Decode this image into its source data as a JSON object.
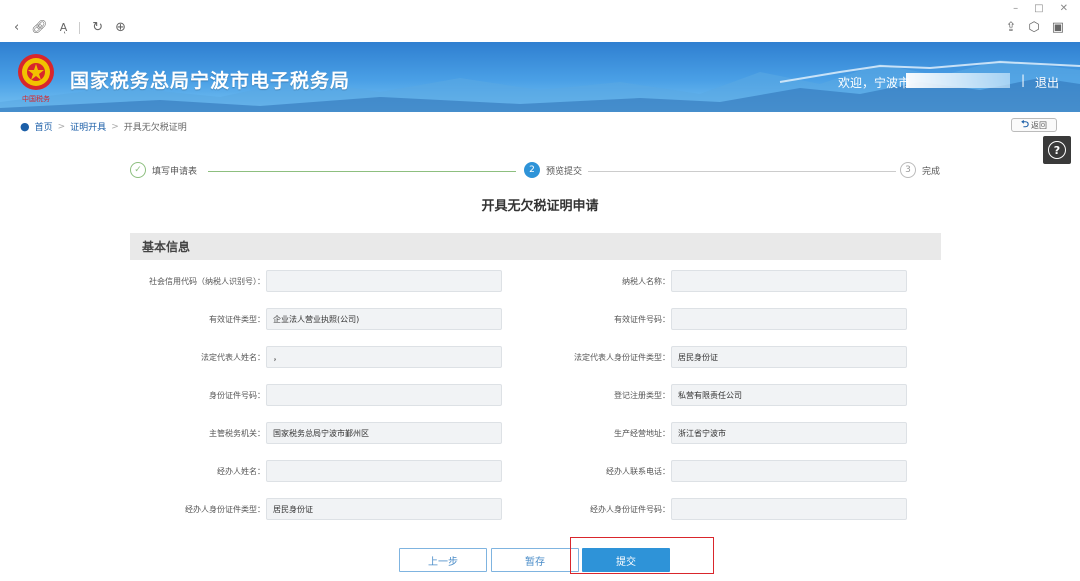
{
  "chrome": {
    "nav_icons": [
      "back-icon",
      "link-icon",
      "read-aloud-icon",
      "refresh-icon",
      "compass-icon"
    ],
    "window_icons": [
      "minimize-icon",
      "restore-icon",
      "close-icon"
    ],
    "right_icons": [
      "share-icon",
      "extension-icon",
      "collections-icon"
    ]
  },
  "header": {
    "title": "国家税务总局宁波市电子税务局",
    "welcome": "欢迎，宁波市",
    "divider": "|",
    "logout": "退出",
    "colors": {
      "banner_top": "#2f7fd0",
      "banner_bottom": "#79c3f2"
    }
  },
  "breadcrumb": {
    "home": "首页",
    "sep": ">",
    "level1": "证明开具",
    "current": "开具无欠税证明"
  },
  "back_label": "返回",
  "help_label": "?",
  "steps": [
    {
      "number": "✓",
      "label": "填写申请表",
      "state": "done"
    },
    {
      "number": "2",
      "label": "预览提交",
      "state": "active"
    },
    {
      "number": "3",
      "label": "完成",
      "state": "todo"
    }
  ],
  "form": {
    "title": "开具无欠税证明申请",
    "section": "基本信息",
    "left_fields": [
      {
        "label": "社会信用代码（纳税人识别号）：",
        "value": ""
      },
      {
        "label": "有效证件类型：",
        "value": "企业法人营业执照(公司)"
      },
      {
        "label": "法定代表人姓名：",
        "value": "，"
      },
      {
        "label": "身份证件号码：",
        "value": ""
      },
      {
        "label": "主管税务机关：",
        "value": "国家税务总局宁波市鄞州区"
      },
      {
        "label": "经办人姓名：",
        "value": ""
      },
      {
        "label": "经办人身份证件类型：",
        "value": "居民身份证"
      }
    ],
    "right_fields": [
      {
        "label": "纳税人名称：",
        "value": ""
      },
      {
        "label": "有效证件号码：",
        "value": ""
      },
      {
        "label": "法定代表人身份证件类型：",
        "value": "居民身份证"
      },
      {
        "label": "登记注册类型：",
        "value": "私营有限责任公司"
      },
      {
        "label": "生产经营地址：",
        "value": "浙江省宁波市"
      },
      {
        "label": "经办人联系电话：",
        "value": ""
      },
      {
        "label": "经办人身份证件号码：",
        "value": ""
      }
    ]
  },
  "actions": {
    "prev": "上一步",
    "save": "暂存",
    "submit": "提交",
    "accent": "#2e93d8",
    "highlight": "#d9262c"
  }
}
